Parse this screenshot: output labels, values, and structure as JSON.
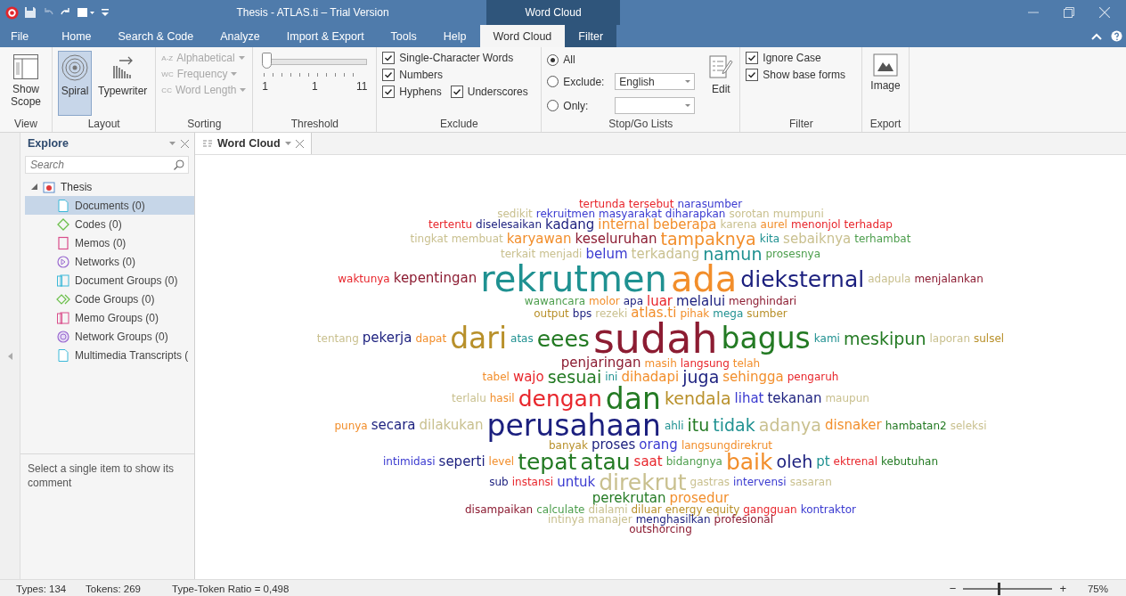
{
  "title_bar": {
    "title": "Thesis - ATLAS.ti – Trial Version",
    "context_group": "Word Cloud"
  },
  "menu_tabs": [
    {
      "label": "File",
      "selected": false,
      "kind": "file"
    },
    {
      "label": "Home",
      "selected": false,
      "kind": "normal"
    },
    {
      "label": "Search & Code",
      "selected": false,
      "kind": "normal"
    },
    {
      "label": "Analyze",
      "selected": false,
      "kind": "normal"
    },
    {
      "label": "Import & Export",
      "selected": false,
      "kind": "normal"
    },
    {
      "label": "Tools",
      "selected": false,
      "kind": "normal"
    },
    {
      "label": "Help",
      "selected": false,
      "kind": "normal"
    },
    {
      "label": "Word Cloud",
      "selected": true,
      "kind": "context"
    },
    {
      "label": "Filter",
      "selected": false,
      "kind": "context"
    }
  ],
  "ribbon": {
    "view": {
      "label": "View",
      "button": "Show Scope"
    },
    "layout": {
      "label": "Layout",
      "buttons": [
        {
          "label": "Spiral",
          "selected": true,
          "kind": "spiral"
        },
        {
          "label": "Typewriter",
          "selected": false,
          "kind": "typewriter"
        }
      ]
    },
    "sorting": {
      "label": "Sorting",
      "items": [
        {
          "badge": "A-Z",
          "label": "Alphabetical",
          "disabled": true
        },
        {
          "badge": "WC",
          "label": "Frequency",
          "disabled": true
        },
        {
          "badge": "CC",
          "label": "Word Length",
          "disabled": true
        }
      ]
    },
    "threshold": {
      "label": "Threshold",
      "level": 0,
      "min_label": "1",
      "value_label": "1",
      "max_label": "11"
    },
    "exclude": {
      "label": "Exclude",
      "options": [
        {
          "label": "Single-Character Words",
          "checked": true
        },
        {
          "label": "Numbers",
          "checked": true
        },
        {
          "label": "Hyphens",
          "checked": true
        },
        {
          "label": "Underscores",
          "checked": true
        }
      ]
    },
    "stop_go": {
      "label": "Stop/Go Lists",
      "options": [
        {
          "label": "All",
          "selected": true
        },
        {
          "label": "Exclude:",
          "selected": false
        },
        {
          "label": "Only:",
          "selected": false
        }
      ],
      "exclude_list": "English",
      "edit": "Edit"
    },
    "filter": {
      "label": "Filter",
      "options": [
        {
          "label": "Ignore Case",
          "checked": true
        },
        {
          "label": "Show base forms",
          "checked": true
        }
      ]
    },
    "export": {
      "label": "Export",
      "button": "Image"
    }
  },
  "explore_panel": {
    "title": "Explore",
    "search": {
      "placeholder": "Search"
    },
    "tree": [
      {
        "label": "Thesis",
        "expanded": true,
        "selected": false,
        "kind": "project",
        "children": [
          {
            "label": "Documents (0)",
            "selected": true,
            "kind": "document"
          },
          {
            "label": "Codes (0)",
            "selected": false,
            "kind": "code"
          },
          {
            "label": "Memos (0)",
            "selected": false,
            "kind": "memo"
          },
          {
            "label": "Networks (0)",
            "selected": false,
            "kind": "network"
          },
          {
            "label": "Document Groups (0)",
            "selected": false,
            "kind": "document-group"
          },
          {
            "label": "Code Groups (0)",
            "selected": false,
            "kind": "code-group"
          },
          {
            "label": "Memo Groups (0)",
            "selected": false,
            "kind": "memo-group"
          },
          {
            "label": "Network Groups (0)",
            "selected": false,
            "kind": "network-group"
          },
          {
            "label": "Multimedia Transcripts (",
            "selected": false,
            "kind": "transcript"
          }
        ]
      }
    ],
    "comment": "Select a single item to show its comment"
  },
  "document_tab": {
    "label": "Word Cloud",
    "selected": true
  },
  "word_cloud": {
    "words": [
      {
        "text": "tertunda",
        "kind": "small",
        "color": "#e8262c"
      },
      {
        "text": "tersebut",
        "kind": "small",
        "color": "#e8262c"
      },
      {
        "text": "narasumber",
        "kind": "small",
        "color": "#3a3ad0"
      },
      {
        "text": "sedikit",
        "kind": "small",
        "color": "#c9c08f"
      },
      {
        "text": "rekruitmen",
        "kind": "small",
        "color": "#3a3ad0"
      },
      {
        "text": "masyarakat",
        "kind": "small",
        "color": "#3a3ad0"
      },
      {
        "text": "diharapkan",
        "kind": "small",
        "color": "#3a3ad0"
      },
      {
        "text": "sorotan",
        "kind": "small",
        "color": "#c9c08f"
      },
      {
        "text": "mumpuni",
        "kind": "small",
        "color": "#c9c08f"
      },
      {
        "text": "tertentu",
        "kind": "small",
        "color": "#e8262c"
      },
      {
        "text": "diselesaikan",
        "kind": "small",
        "color": "#1b1f7e"
      },
      {
        "text": "kadang",
        "kind": "medium",
        "color": "#1b1f7e"
      },
      {
        "text": "internal",
        "kind": "medium",
        "color": "#f28e2b"
      },
      {
        "text": "beberapa",
        "kind": "medium",
        "color": "#f28e2b"
      },
      {
        "text": "karena",
        "kind": "small",
        "color": "#c9c08f"
      },
      {
        "text": "aurel",
        "kind": "small",
        "color": "#f28e2b"
      },
      {
        "text": "menonjol",
        "kind": "small",
        "color": "#e8262c"
      },
      {
        "text": "terhadap",
        "kind": "small",
        "color": "#e8262c"
      },
      {
        "text": "tingkat",
        "kind": "small",
        "color": "#c9c08f"
      },
      {
        "text": "membuat",
        "kind": "small",
        "color": "#c9c08f"
      },
      {
        "text": "karyawan",
        "kind": "medium",
        "color": "#f28e2b"
      },
      {
        "text": "keseluruhan",
        "kind": "medium",
        "color": "#8c1c32"
      },
      {
        "text": "tampaknya",
        "kind": "large",
        "color": "#f28e2b"
      },
      {
        "text": "kita",
        "kind": "small",
        "color": "#1f9191"
      },
      {
        "text": "sebaiknya",
        "kind": "medium",
        "color": "#c9c08f"
      },
      {
        "text": "terhambat",
        "kind": "small",
        "color": "#4d9e4d"
      },
      {
        "text": "terkait",
        "kind": "small",
        "color": "#c9c08f"
      },
      {
        "text": "menjadi",
        "kind": "small",
        "color": "#c9c08f"
      },
      {
        "text": "belum",
        "kind": "medium",
        "color": "#3a3ad0"
      },
      {
        "text": "terkadang",
        "kind": "medium",
        "color": "#c9c08f"
      },
      {
        "text": "namun",
        "kind": "large",
        "color": "#1f9191"
      },
      {
        "text": "prosesnya",
        "kind": "small",
        "color": "#4d9e4d"
      },
      {
        "text": "waktunya",
        "kind": "small",
        "color": "#e8262c"
      },
      {
        "text": "kepentingan",
        "kind": "medium",
        "color": "#8c1c32"
      },
      {
        "text": "rekrutmen",
        "kind": "huge",
        "color": "#1f9191"
      },
      {
        "text": "ada",
        "kind": "huge",
        "color": "#f28e2b"
      },
      {
        "text": "dieksternal",
        "kind": "xlarge",
        "color": "#1b1f7e"
      },
      {
        "text": "adapula",
        "kind": "small",
        "color": "#c9c08f"
      },
      {
        "text": "menjalankan",
        "kind": "small",
        "color": "#8c1c32"
      },
      {
        "text": "wawancara",
        "kind": "small",
        "color": "#4d9e4d"
      },
      {
        "text": "molor",
        "kind": "small",
        "color": "#f28e2b"
      },
      {
        "text": "apa",
        "kind": "small",
        "color": "#1b1f7e"
      },
      {
        "text": "luar",
        "kind": "medium",
        "color": "#e8262c"
      },
      {
        "text": "melalui",
        "kind": "medium",
        "color": "#1b1f7e"
      },
      {
        "text": "menghindari",
        "kind": "small",
        "color": "#8c1c32"
      },
      {
        "text": "output",
        "kind": "small",
        "color": "#b8902a"
      },
      {
        "text": "bps",
        "kind": "small",
        "color": "#1b1f7e"
      },
      {
        "text": "rezeki",
        "kind": "small",
        "color": "#c9c08f"
      },
      {
        "text": "atlas.ti",
        "kind": "medium",
        "color": "#f28e2b"
      },
      {
        "text": "pihak",
        "kind": "small",
        "color": "#f28e2b"
      },
      {
        "text": "mega",
        "kind": "small",
        "color": "#1f9191"
      },
      {
        "text": "sumber",
        "kind": "small",
        "color": "#b8902a"
      },
      {
        "text": "tentang",
        "kind": "small",
        "color": "#c9c08f"
      },
      {
        "text": "pekerja",
        "kind": "medium",
        "color": "#1b1f7e"
      },
      {
        "text": "dapat",
        "kind": "small",
        "color": "#f28e2b"
      },
      {
        "text": "dari",
        "kind": "xxlarge",
        "color": "#b8902a"
      },
      {
        "text": "atas",
        "kind": "small",
        "color": "#1f9191"
      },
      {
        "text": "eees",
        "kind": "xlarge",
        "color": "#237a23"
      },
      {
        "text": "sudah",
        "kind": "giant",
        "color": "#8c1c32"
      },
      {
        "text": "bagus",
        "kind": "xxlarge",
        "color": "#237a23"
      },
      {
        "text": "kami",
        "kind": "small",
        "color": "#1f9191"
      },
      {
        "text": "meskipun",
        "kind": "large",
        "color": "#237a23"
      },
      {
        "text": "laporan",
        "kind": "small",
        "color": "#c9c08f"
      },
      {
        "text": "sulsel",
        "kind": "small",
        "color": "#b8902a"
      },
      {
        "text": "penjaringan",
        "kind": "medium",
        "color": "#8c1c32"
      },
      {
        "text": "masih",
        "kind": "small",
        "color": "#f28e2b"
      },
      {
        "text": "langsung",
        "kind": "small",
        "color": "#e8262c"
      },
      {
        "text": "telah",
        "kind": "small",
        "color": "#f28e2b"
      },
      {
        "text": "tabel",
        "kind": "small",
        "color": "#f28e2b"
      },
      {
        "text": "wajo",
        "kind": "medium",
        "color": "#e8262c"
      },
      {
        "text": "sesuai",
        "kind": "large",
        "color": "#237a23"
      },
      {
        "text": "ini",
        "kind": "small",
        "color": "#1f9191"
      },
      {
        "text": "dihadapi",
        "kind": "medium",
        "color": "#f28e2b"
      },
      {
        "text": "juga",
        "kind": "large",
        "color": "#1b1f7e"
      },
      {
        "text": "sehingga",
        "kind": "medium",
        "color": "#f28e2b"
      },
      {
        "text": "pengaruh",
        "kind": "small",
        "color": "#e8262c"
      },
      {
        "text": "terlalu",
        "kind": "small",
        "color": "#c9c08f"
      },
      {
        "text": "hasil",
        "kind": "small",
        "color": "#f28e2b"
      },
      {
        "text": "dengan",
        "kind": "xlarge",
        "color": "#e8262c"
      },
      {
        "text": "dan",
        "kind": "xxlarge",
        "color": "#237a23"
      },
      {
        "text": "kendala",
        "kind": "large",
        "color": "#b8902a"
      },
      {
        "text": "lihat",
        "kind": "medium",
        "color": "#3a3ad0"
      },
      {
        "text": "tekanan",
        "kind": "medium",
        "color": "#1b1f7e"
      },
      {
        "text": "maupun",
        "kind": "small",
        "color": "#c9c08f"
      },
      {
        "text": "punya",
        "kind": "small",
        "color": "#f28e2b"
      },
      {
        "text": "secara",
        "kind": "medium",
        "color": "#1b1f7e"
      },
      {
        "text": "dilakukan",
        "kind": "medium",
        "color": "#c9c08f"
      },
      {
        "text": "perusahaan",
        "kind": "xxlarge",
        "color": "#1b1f7e"
      },
      {
        "text": "ahli",
        "kind": "small",
        "color": "#1f9191"
      },
      {
        "text": "itu",
        "kind": "large",
        "color": "#237a23"
      },
      {
        "text": "tidak",
        "kind": "large",
        "color": "#1f9191"
      },
      {
        "text": "adanya",
        "kind": "large",
        "color": "#c9c08f"
      },
      {
        "text": "disnaker",
        "kind": "medium",
        "color": "#f28e2b"
      },
      {
        "text": "hambatan2",
        "kind": "small",
        "color": "#237a23"
      },
      {
        "text": "seleksi",
        "kind": "small",
        "color": "#c9c08f"
      },
      {
        "text": "banyak",
        "kind": "small",
        "color": "#b8902a"
      },
      {
        "text": "proses",
        "kind": "medium",
        "color": "#1b1f7e"
      },
      {
        "text": "orang",
        "kind": "medium",
        "color": "#3a3ad0"
      },
      {
        "text": "langsungdirekrut",
        "kind": "small",
        "color": "#f28e2b"
      },
      {
        "text": "intimidasi",
        "kind": "small",
        "color": "#3a3ad0"
      },
      {
        "text": "seperti",
        "kind": "medium",
        "color": "#1b1f7e"
      },
      {
        "text": "level",
        "kind": "small",
        "color": "#f28e2b"
      },
      {
        "text": "tepat",
        "kind": "xlarge",
        "color": "#237a23"
      },
      {
        "text": "atau",
        "kind": "xlarge",
        "color": "#237a23"
      },
      {
        "text": "saat",
        "kind": "medium",
        "color": "#e8262c"
      },
      {
        "text": "bidangnya",
        "kind": "small",
        "color": "#4d9e4d"
      },
      {
        "text": "baik",
        "kind": "xlarge",
        "color": "#f28e2b"
      },
      {
        "text": "oleh",
        "kind": "large",
        "color": "#1b1f7e"
      },
      {
        "text": "pt",
        "kind": "medium",
        "color": "#1f9191"
      },
      {
        "text": "ektrenal",
        "kind": "small",
        "color": "#e8262c"
      },
      {
        "text": "kebutuhan",
        "kind": "small",
        "color": "#237a23"
      },
      {
        "text": "sub",
        "kind": "small",
        "color": "#1b1f7e"
      },
      {
        "text": "instansi",
        "kind": "small",
        "color": "#e8262c"
      },
      {
        "text": "untuk",
        "kind": "medium",
        "color": "#3a3ad0"
      },
      {
        "text": "direkrut",
        "kind": "xlarge",
        "color": "#c9c08f"
      },
      {
        "text": "gastras",
        "kind": "small",
        "color": "#c9c08f"
      },
      {
        "text": "intervensi",
        "kind": "small",
        "color": "#3a3ad0"
      },
      {
        "text": "sasaran",
        "kind": "small",
        "color": "#c9c08f"
      },
      {
        "text": "perekrutan",
        "kind": "medium",
        "color": "#237a23"
      },
      {
        "text": "prosedur",
        "kind": "medium",
        "color": "#f28e2b"
      },
      {
        "text": "disampaikan",
        "kind": "small",
        "color": "#8c1c32"
      },
      {
        "text": "calculate",
        "kind": "small",
        "color": "#4d9e4d"
      },
      {
        "text": "dialami",
        "kind": "small",
        "color": "#c9c08f"
      },
      {
        "text": "diluar",
        "kind": "small",
        "color": "#b8902a"
      },
      {
        "text": "energy",
        "kind": "small",
        "color": "#b8902a"
      },
      {
        "text": "equity",
        "kind": "small",
        "color": "#b8902a"
      },
      {
        "text": "gangguan",
        "kind": "small",
        "color": "#e8262c"
      },
      {
        "text": "kontraktor",
        "kind": "small",
        "color": "#3a3ad0"
      },
      {
        "text": "intinya",
        "kind": "small",
        "color": "#c9c08f"
      },
      {
        "text": "manajer",
        "kind": "small",
        "color": "#c9c08f"
      },
      {
        "text": "menghasilkan",
        "kind": "small",
        "color": "#1b1f7e"
      },
      {
        "text": "profesional",
        "kind": "small",
        "color": "#8c1c32"
      },
      {
        "text": "outshorcing",
        "kind": "small",
        "color": "#8c1c32"
      }
    ]
  },
  "status_bar": {
    "types": "Types: 134",
    "tokens": "Tokens: 269",
    "ratio": "Type-Token Ratio = 0,498",
    "zoom_out": "−",
    "zoom_in": "+",
    "zoom": {
      "level": 0.4,
      "reading": "75%"
    }
  }
}
